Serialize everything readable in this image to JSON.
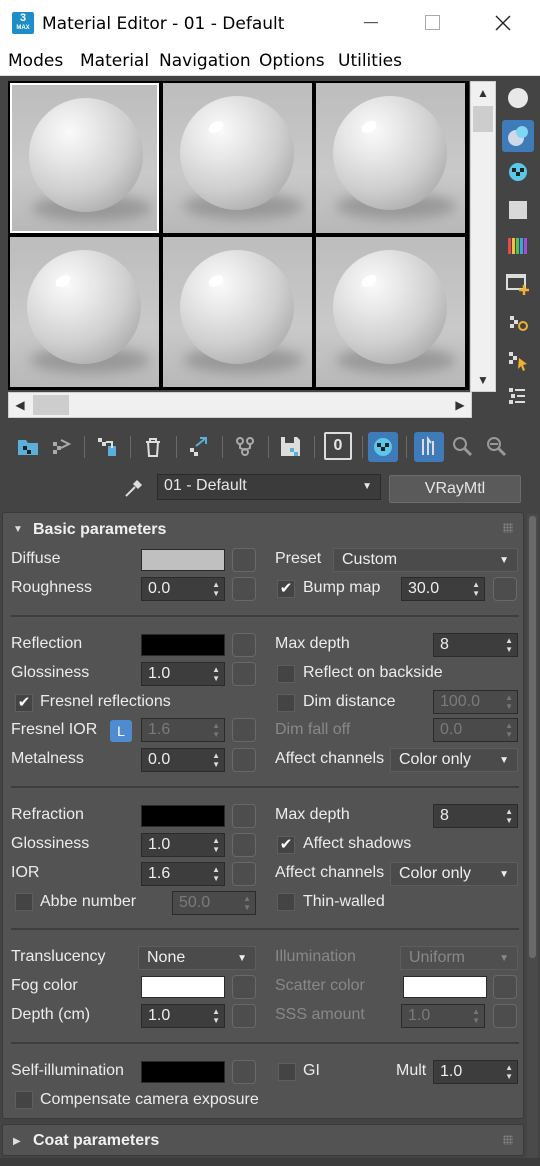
{
  "window": {
    "app_badge": "3",
    "app_badge_sub": "MAX",
    "title": "Material Editor - 01 - Default"
  },
  "menu": {
    "items": [
      "Modes",
      "Material",
      "Navigation",
      "Options",
      "Utilities"
    ]
  },
  "slots": {
    "count": 6,
    "selected_index": 0
  },
  "side_tools": [
    "sample-type-sphere-icon",
    "backlight-icon",
    "background-checker-icon",
    "sample-uv-tiling-icon",
    "video-color-check-icon",
    "make-preview-icon",
    "options-icon",
    "select-by-material-icon",
    "material-map-navigator-icon"
  ],
  "toolbar": {
    "icons": [
      "get-material-icon",
      "put-to-scene-icon",
      "assign-to-selection-icon",
      "reset-map-icon",
      "make-unique-icon",
      "put-to-library-icon",
      "material-id-channel-icon",
      "show-shaded-material-icon",
      "show-end-result-icon",
      "go-to-parent-icon",
      "go-forward-to-sibling-icon"
    ],
    "material_id": "0"
  },
  "name_bar": {
    "material_name": "01 - Default",
    "material_type": "VRayMtl"
  },
  "basic": {
    "title": "Basic parameters",
    "diffuse_label": "Diffuse",
    "diffuse_color": "#c0c0c0",
    "preset_label": "Preset",
    "preset_value": "Custom",
    "roughness_label": "Roughness",
    "roughness_value": "0.0",
    "bump_label": "Bump map",
    "bump_checked": true,
    "bump_value": "30.0",
    "reflection_label": "Reflection",
    "reflection_color": "#000000",
    "refl_max_depth_label": "Max depth",
    "refl_max_depth": "8",
    "glossiness_label": "Glossiness",
    "glossiness_value": "1.0",
    "reflect_backside_label": "Reflect on backside",
    "fresnel_label": "Fresnel reflections",
    "fresnel_checked": true,
    "dim_distance_label": "Dim distance",
    "dim_distance_value": "100.0",
    "fresnel_ior_label": "Fresnel IOR",
    "fresnel_ior_lock": "L",
    "fresnel_ior_value": "1.6",
    "dim_falloff_label": "Dim fall off",
    "dim_falloff_value": "0.0",
    "metalness_label": "Metalness",
    "metalness_value": "0.0",
    "refl_affect_label": "Affect channels",
    "refl_affect_value": "Color only",
    "refraction_label": "Refraction",
    "refraction_color": "#000000",
    "refr_max_depth_label": "Max depth",
    "refr_max_depth": "8",
    "refr_glossiness_label": "Glossiness",
    "refr_glossiness_value": "1.0",
    "affect_shadows_label": "Affect shadows",
    "affect_shadows_checked": true,
    "ior_label": "IOR",
    "ior_value": "1.6",
    "refr_affect_label": "Affect channels",
    "refr_affect_value": "Color only",
    "abbe_label": "Abbe number",
    "abbe_value": "50.0",
    "thin_walled_label": "Thin-walled",
    "translucency_label": "Translucency",
    "translucency_value": "None",
    "illumination_label": "Illumination",
    "illumination_value": "Uniform",
    "fog_color_label": "Fog color",
    "fog_color": "#ffffff",
    "scatter_color_label": "Scatter color",
    "scatter_color": "#ffffff",
    "depth_label": "Depth (cm)",
    "depth_value": "1.0",
    "sss_label": "SSS amount",
    "sss_value": "1.0",
    "self_illum_label": "Self-illumination",
    "self_illum_color": "#000000",
    "gi_label": "GI",
    "mult_label": "Mult",
    "mult_value": "1.0",
    "compensate_label": "Compensate camera exposure"
  },
  "coat": {
    "title": "Coat parameters"
  },
  "colors": {
    "accent": "#3f7bb8",
    "panel_bg": "#535353",
    "window_bg": "#444444"
  }
}
